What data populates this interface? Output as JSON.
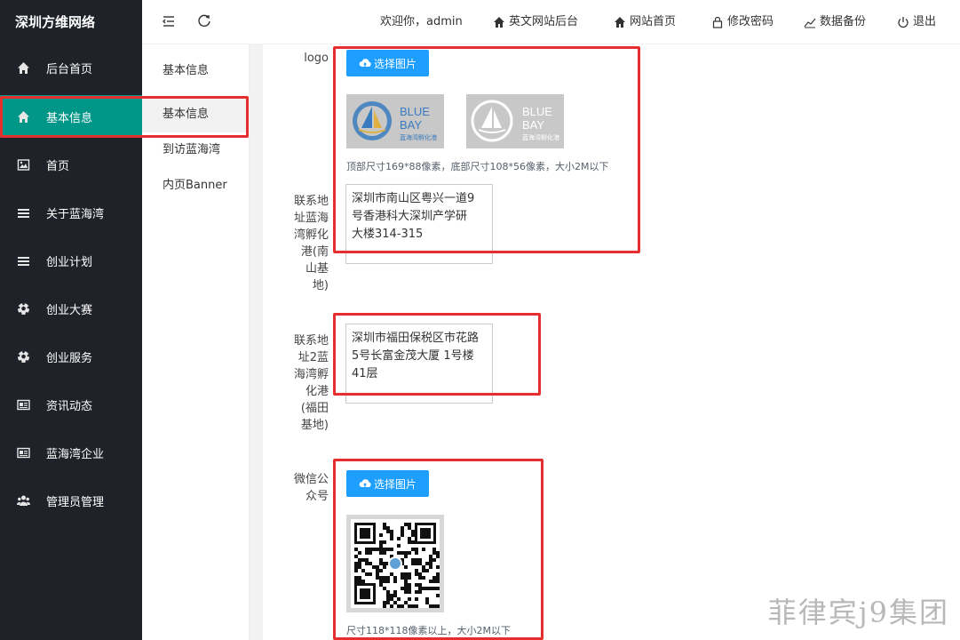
{
  "brand": "深圳方维网络",
  "nav": [
    {
      "label": "后台首页",
      "icon": "home-icon"
    },
    {
      "label": "基本信息",
      "icon": "home-icon"
    },
    {
      "label": "首页",
      "icon": "image-icon"
    },
    {
      "label": "关于蓝海湾",
      "icon": "list-icon"
    },
    {
      "label": "创业计划",
      "icon": "list-icon"
    },
    {
      "label": "创业大赛",
      "icon": "football-icon"
    },
    {
      "label": "创业服务",
      "icon": "football-icon"
    },
    {
      "label": "资讯动态",
      "icon": "newspaper-icon"
    },
    {
      "label": "蓝海湾企业",
      "icon": "newspaper-icon"
    },
    {
      "label": "管理员管理",
      "icon": "users-icon"
    }
  ],
  "subnav": [
    "基本信息",
    "基本信息",
    "到访蓝海湾",
    "内页Banner"
  ],
  "header": {
    "welcome": "欢迎你，admin",
    "links": [
      "英文网站后台",
      "网站首页",
      "修改密码",
      "数据备份",
      "退出"
    ]
  },
  "form": {
    "logo_label": "logo",
    "upload_label": "选择图片",
    "logo_text": "BLUE BAY",
    "logo_sub": "蓝海湾孵化港",
    "logo_hint": "顶部尺寸169*88像素，底部尺寸108*56像素，大小2M以下",
    "addr1_label": "联系地址蓝海湾孵化港(南山基地)",
    "addr1_value": "深圳市南山区粤兴一道9\n号香港科大深圳产学研\n大楼314-315",
    "addr2_label": "联系地址2蓝海湾孵化港(福田基地)",
    "addr2_value": "深圳市福田保税区市花路\n5号长富金茂大厦 1号楼\n41层",
    "wechat_label": "微信公众号",
    "wechat_hint": "尺寸118*118像素以上，大小2M以下"
  },
  "watermark": "菲律宾j9集团",
  "colors": {
    "sidebar": "#20222a",
    "active": "#009688",
    "button": "#1e9fff",
    "highlight": "#e62e2e"
  }
}
